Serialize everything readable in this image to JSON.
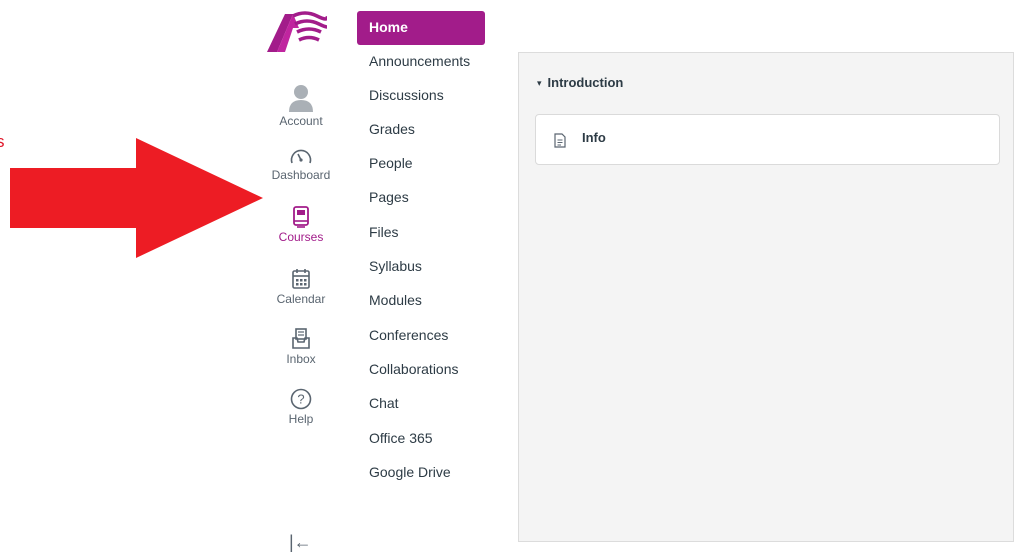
{
  "annotation": {
    "edge_glyph": "s",
    "arrow_color": "#ed1c24"
  },
  "brand": {
    "accent": "#a21c8a"
  },
  "global_nav": {
    "items": [
      {
        "label": "Account",
        "icon": "user-avatar-icon"
      },
      {
        "label": "Dashboard",
        "icon": "speedometer-icon"
      },
      {
        "label": "Courses",
        "icon": "book-icon",
        "active": true
      },
      {
        "label": "Calendar",
        "icon": "calendar-icon"
      },
      {
        "label": "Inbox",
        "icon": "inbox-icon"
      },
      {
        "label": "Help",
        "icon": "question-circle-icon"
      }
    ],
    "collapse_glyph": "|←"
  },
  "course_nav": {
    "items": [
      {
        "label": "Home",
        "active": true
      },
      {
        "label": "Announcements"
      },
      {
        "label": "Discussions"
      },
      {
        "label": "Grades"
      },
      {
        "label": "People"
      },
      {
        "label": "Pages"
      },
      {
        "label": "Files"
      },
      {
        "label": "Syllabus"
      },
      {
        "label": "Modules"
      },
      {
        "label": "Conferences"
      },
      {
        "label": "Collaborations"
      },
      {
        "label": "Chat"
      },
      {
        "label": "Office 365"
      },
      {
        "label": "Google Drive"
      }
    ]
  },
  "module": {
    "caret": "▾",
    "title": "Introduction",
    "items": [
      {
        "title": "Info",
        "icon": "document-icon"
      }
    ]
  }
}
